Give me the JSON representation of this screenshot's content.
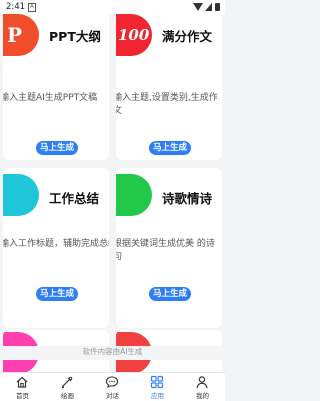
{
  "status_bar": {
    "time": "2:41",
    "sim_label": "A"
  },
  "cards": [
    {
      "title": "PPT大纲",
      "thumb_glyph": "P",
      "thumb_color": "#f04e2b",
      "description": "输入主题AI生成PPT文稿",
      "button": "马上生成"
    },
    {
      "title": "满分作文",
      "thumb_glyph": "100",
      "thumb_color": "#f0252f",
      "description": "输入主题,设置类别,生成作文",
      "button": "马上生成"
    },
    {
      "title": "工作总结",
      "thumb_glyph": "",
      "thumb_color": "#1fc6d8",
      "description": "输入工作标题，辅助完成总结",
      "button": "马上生成"
    },
    {
      "title": "诗歌情诗",
      "thumb_glyph": "",
      "thumb_color": "#22c84a",
      "description": "根据关键词生成优美 的诗句",
      "button": "马上生成"
    }
  ],
  "partial_cards": [
    {
      "thumb_color": "#ff3fb0"
    },
    {
      "thumb_color": "#f04040"
    }
  ],
  "footer_note": "软件内容由AI生成",
  "tabs": [
    {
      "label": "首页",
      "icon": "home-icon"
    },
    {
      "label": "绘画",
      "icon": "brush-icon"
    },
    {
      "label": "对话",
      "icon": "chat-icon"
    },
    {
      "label": "应用",
      "icon": "apps-icon",
      "active": true
    },
    {
      "label": "我的",
      "icon": "person-icon"
    }
  ],
  "accent_color": "#2e7ef6"
}
